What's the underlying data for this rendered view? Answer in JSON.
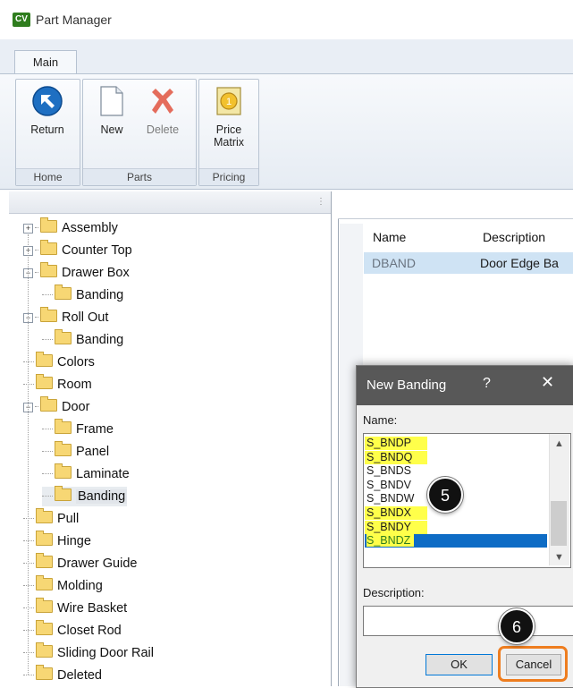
{
  "window": {
    "logo": "CV",
    "title": "Part Manager"
  },
  "tabs": [
    {
      "label": "Main"
    }
  ],
  "ribbon": {
    "groups": [
      {
        "label": "Home",
        "buttons": [
          {
            "label": "Return",
            "icon": "return-arrow-icon"
          }
        ]
      },
      {
        "label": "Parts",
        "buttons": [
          {
            "label": "New",
            "icon": "new-document-icon"
          },
          {
            "label": "Delete",
            "icon": "delete-x-icon"
          }
        ]
      },
      {
        "label": "Pricing",
        "buttons": [
          {
            "label": "Price Matrix",
            "icon": "price-matrix-icon"
          }
        ]
      }
    ]
  },
  "tree": {
    "items": [
      {
        "label": "Assembly",
        "level": 0,
        "expander": "+"
      },
      {
        "label": "Counter Top",
        "level": 0,
        "expander": "+"
      },
      {
        "label": "Drawer Box",
        "level": 0,
        "expander": "-"
      },
      {
        "label": "Banding",
        "level": 1
      },
      {
        "label": "Roll Out",
        "level": 0,
        "expander": "-"
      },
      {
        "label": "Banding",
        "level": 1
      },
      {
        "label": "Colors",
        "level": 0
      },
      {
        "label": "Room",
        "level": 0
      },
      {
        "label": "Door",
        "level": 0,
        "expander": "-"
      },
      {
        "label": "Frame",
        "level": 1
      },
      {
        "label": "Panel",
        "level": 1
      },
      {
        "label": "Laminate",
        "level": 1
      },
      {
        "label": "Banding",
        "level": 1,
        "selected": true
      },
      {
        "label": "Pull",
        "level": 0
      },
      {
        "label": "Hinge",
        "level": 0
      },
      {
        "label": "Drawer Guide",
        "level": 0
      },
      {
        "label": "Molding",
        "level": 0
      },
      {
        "label": "Wire Basket",
        "level": 0
      },
      {
        "label": "Closet Rod",
        "level": 0
      },
      {
        "label": "Sliding Door Rail",
        "level": 0
      },
      {
        "label": "Deleted",
        "level": 0
      }
    ]
  },
  "grid": {
    "columns": [
      "Name",
      "Description"
    ],
    "rows": [
      {
        "name": "DBAND",
        "description": "Door Edge Ba"
      }
    ]
  },
  "dialog": {
    "title": "New Banding",
    "help": "?",
    "close": "✕",
    "name_label": "Name:",
    "names": [
      {
        "value": "S_BNDP",
        "highlight": true
      },
      {
        "value": "S_BNDQ",
        "highlight": true
      },
      {
        "value": "S_BNDS",
        "highlight": false
      },
      {
        "value": "S_BNDV",
        "highlight": false
      },
      {
        "value": "S_BNDW",
        "highlight": false
      },
      {
        "value": "S_BNDX",
        "highlight": true
      },
      {
        "value": "S_BNDY",
        "highlight": true
      },
      {
        "value": "S_BNDZ",
        "highlight": true,
        "selected": true
      }
    ],
    "description_label": "Description:",
    "description_value": "",
    "ok_label": "OK",
    "cancel_label": "Cancel"
  },
  "callouts": [
    {
      "label": "5"
    },
    {
      "label": "6"
    }
  ],
  "colors": {
    "accent_orange": "#ee7d1f",
    "highlight_yellow": "#ffff4a",
    "selection_blue": "#0e6cc5"
  }
}
